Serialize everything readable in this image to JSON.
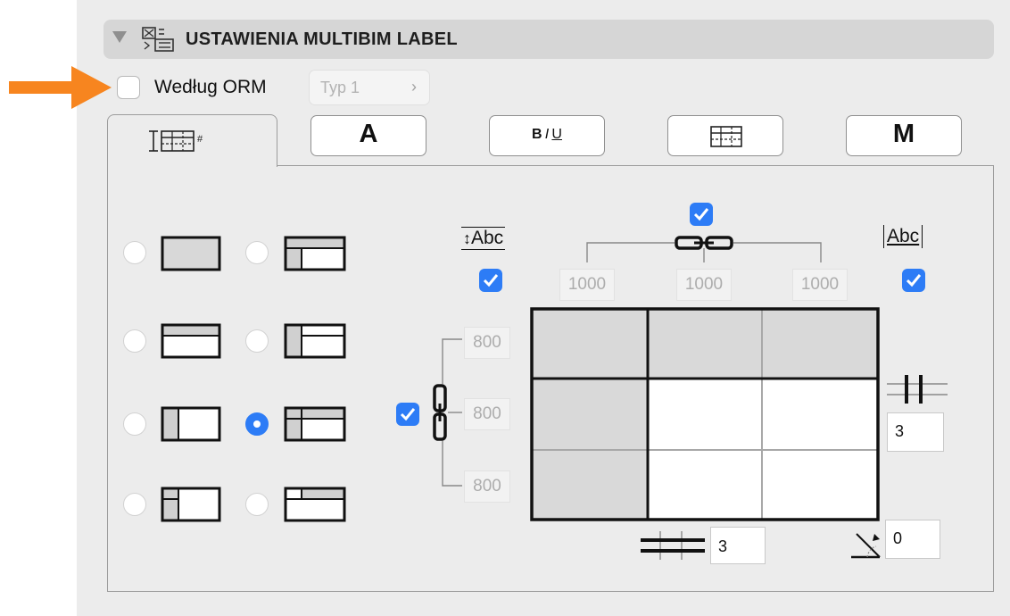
{
  "header": {
    "title": "USTAWIENIA MULTIBIM LABEL",
    "collapse_icon": "disclosure-triangle-icon",
    "section_icon": "multibim-label-icon"
  },
  "orm": {
    "checkbox_label": "Według ORM",
    "checked": false,
    "type_select": "Typ 1"
  },
  "tabs": [
    {
      "name": "table-number-icon",
      "active": true
    },
    {
      "label": "A",
      "name": "font-icon",
      "active": false
    },
    {
      "label_bold": "B",
      "label_italic": "I",
      "label_underline": "U",
      "name": "text-style-icon",
      "active": false
    },
    {
      "name": "grid-lines-icon",
      "active": false
    },
    {
      "label": "M",
      "name": "marker-icon",
      "active": false
    }
  ],
  "layout_options": {
    "selected_index": 5,
    "count": 8
  },
  "dimensions": {
    "row_height_checkbox": true,
    "link_columns_checkbox": true,
    "fit_width_checkbox": true,
    "link_rows_checkbox": true,
    "column_widths": [
      "1000",
      "1000",
      "1000"
    ],
    "row_heights": [
      "800",
      "800",
      "800"
    ],
    "row_height_label": "Abc",
    "fit_width_label": "Abc",
    "columns_count": "3",
    "rows_count": "3",
    "rotation": "0"
  },
  "colors": {
    "accent": "#2d7cf6",
    "arrow": "#f7851f",
    "panel": "#ececec",
    "header": "#d6d6d6"
  }
}
